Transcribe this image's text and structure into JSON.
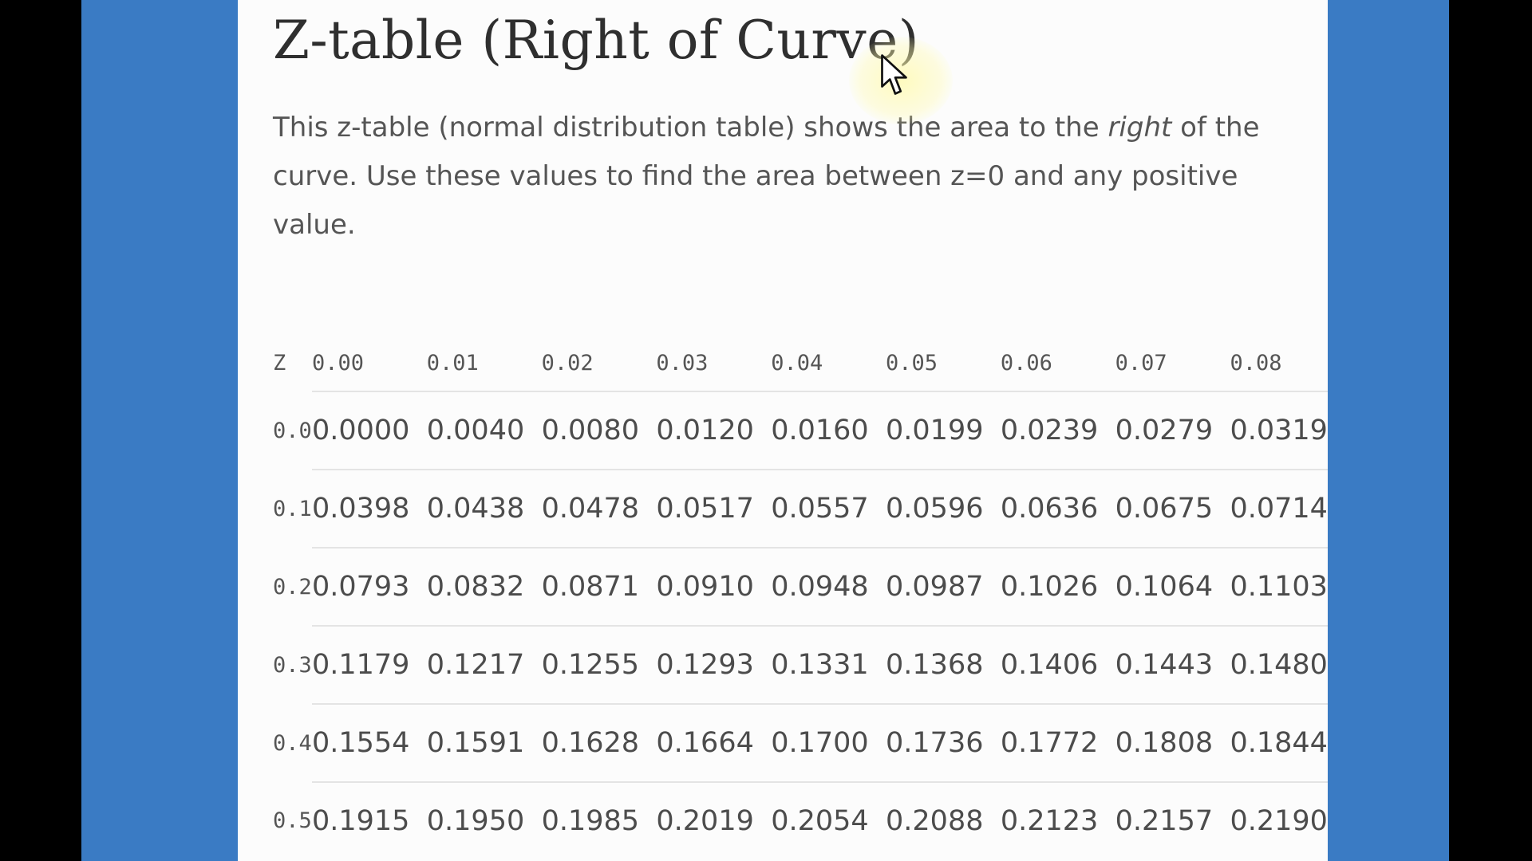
{
  "title": "Z-table (Right of Curve)",
  "description": {
    "part1": "This z-table (normal distribution table) shows the area to the ",
    "emphasis": "right",
    "part2": " of the curve. Use these values to find the area between z=0 and any positive value."
  },
  "table": {
    "headers": [
      "Z",
      "0.00",
      "0.01",
      "0.02",
      "0.03",
      "0.04",
      "0.05",
      "0.06",
      "0.07",
      "0.08"
    ],
    "rows": [
      {
        "z": "0.0",
        "values": [
          "0.0000",
          "0.0040",
          "0.0080",
          "0.0120",
          "0.0160",
          "0.0199",
          "0.0239",
          "0.0279",
          "0.0319"
        ]
      },
      {
        "z": "0.1",
        "values": [
          "0.0398",
          "0.0438",
          "0.0478",
          "0.0517",
          "0.0557",
          "0.0596",
          "0.0636",
          "0.0675",
          "0.0714"
        ]
      },
      {
        "z": "0.2",
        "values": [
          "0.0793",
          "0.0832",
          "0.0871",
          "0.0910",
          "0.0948",
          "0.0987",
          "0.1026",
          "0.1064",
          "0.1103"
        ]
      },
      {
        "z": "0.3",
        "values": [
          "0.1179",
          "0.1217",
          "0.1255",
          "0.1293",
          "0.1331",
          "0.1368",
          "0.1406",
          "0.1443",
          "0.1480"
        ]
      },
      {
        "z": "0.4",
        "values": [
          "0.1554",
          "0.1591",
          "0.1628",
          "0.1664",
          "0.1700",
          "0.1736",
          "0.1772",
          "0.1808",
          "0.1844"
        ]
      },
      {
        "z": "0.5",
        "values": [
          "0.1915",
          "0.1950",
          "0.1985",
          "0.2019",
          "0.2054",
          "0.2088",
          "0.2123",
          "0.2157",
          "0.2190"
        ]
      }
    ]
  },
  "colors": {
    "side_background": "#3a7bc4",
    "page_background": "#fcfcfc",
    "cursor_highlight": "#fffaaa"
  },
  "icons": {
    "cursor": "mouse-pointer-icon"
  }
}
